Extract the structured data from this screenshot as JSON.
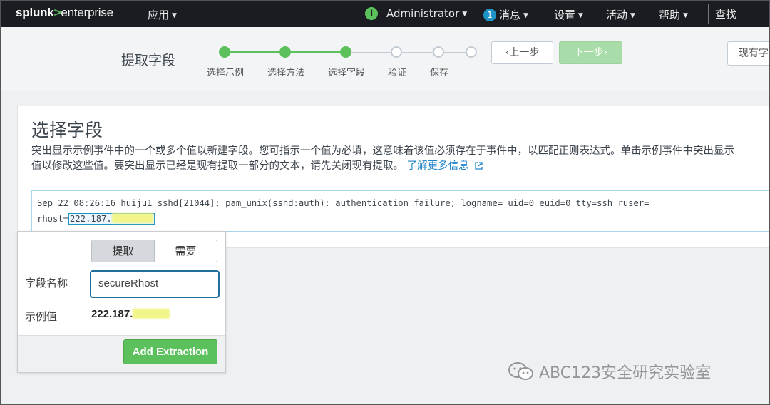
{
  "topnav": {
    "logo_main": "splunk",
    "logo_gt": ">",
    "logo_rest": "enterprise",
    "apps_label": "应用",
    "user_label": "Administrator",
    "messages_count": "1",
    "messages_label": "消息",
    "settings_label": "设置",
    "activity_label": "活动",
    "help_label": "帮助",
    "search_label": "查找"
  },
  "wizard": {
    "title": "提取字段",
    "steps": [
      {
        "label": "选择示例",
        "state": "done"
      },
      {
        "label": "选择方法",
        "state": "done"
      },
      {
        "label": "选择字段",
        "state": "done"
      },
      {
        "label": "验证",
        "state": "todo"
      },
      {
        "label": "保存",
        "state": "todo"
      }
    ],
    "prev_label": "上一步",
    "next_label": "下一步",
    "existing_label": "现有字"
  },
  "panel": {
    "title": "选择字段",
    "desc_line1": "突出显示示例事件中的一个或多个值以新建字段。您可指示一个值为必填，这意味着该值必须存在于事件中，以匹配正则表达式。单击示例事件中突出显示",
    "desc_line2": "值以修改这些值。要突出显示已经是现有提取一部分的文本，请先关闭现有提取。",
    "learn_more": "了解更多信息",
    "event_line1": "Sep 22 08:26:16 huiju1 sshd[21044]: pam_unix(sshd:auth): authentication failure; logname= uid=0 euid=0 tty=ssh ruser=",
    "event_line2_prefix": "rhost=",
    "event_selected": "222.187."
  },
  "popover": {
    "tab_extract": "提取",
    "tab_require": "需要",
    "field_name_label": "字段名称",
    "field_name_value": "secureRhost",
    "sample_label": "示例值",
    "sample_value": "222.187.",
    "add_button": "Add Extraction"
  },
  "watermark": "ABC123安全研究实验室",
  "colors": {
    "nav_bg": "#1a1c21",
    "accent_green": "#5cc05c",
    "link_blue": "#1e83c6",
    "highlight_yellow": "#f1f58a"
  }
}
